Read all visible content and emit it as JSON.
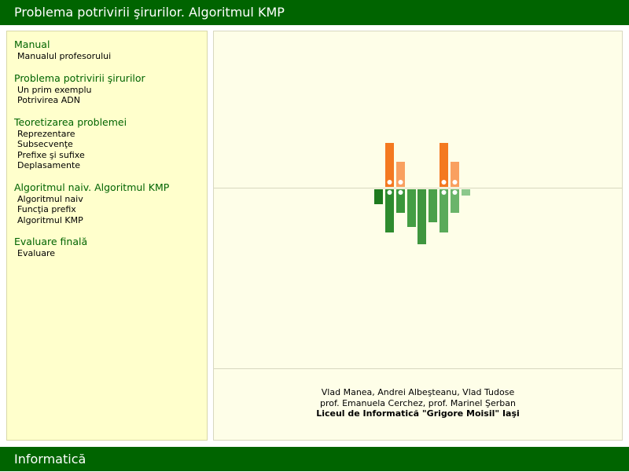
{
  "header": {
    "title": "Problema potrivirii şirurilor. Algoritmul KMP"
  },
  "sidebar": {
    "sections": [
      {
        "title": "Manual",
        "items": [
          "Manualul profesorului"
        ]
      },
      {
        "title": "Problema potrivirii şirurilor",
        "items": [
          "Un prim exemplu",
          "Potrivirea ADN"
        ]
      },
      {
        "title": "Teoretizarea problemei",
        "items": [
          "Reprezentare",
          "Subsecvenţe",
          "Prefixe şi sufixe",
          "Deplasamente"
        ]
      },
      {
        "title": "Algoritmul naiv. Algoritmul KMP",
        "items": [
          "Algoritmul naiv",
          "Funcţia prefix",
          "Algoritmul KMP"
        ]
      },
      {
        "title": "Evaluare finală",
        "items": [
          "Evaluare"
        ]
      }
    ]
  },
  "credits": {
    "authors": "Vlad Manea, Andrei Albeşteanu, Vlad Tudose",
    "teachers": "prof. Emanuela Cerchez, prof. Marinel Şerban",
    "school": "Liceul de Informatică \"Grigore Moisil\" Iaşi"
  },
  "footer": {
    "label": "Informatică"
  },
  "colors": {
    "brand_green": "#006400",
    "sidebar_bg": "#ffffcc",
    "content_bg": "#fefee8",
    "logo_orange": "#f47920",
    "logo_orange_light": "#f9a060"
  },
  "logo": {
    "name": "bar-logo-icon"
  }
}
